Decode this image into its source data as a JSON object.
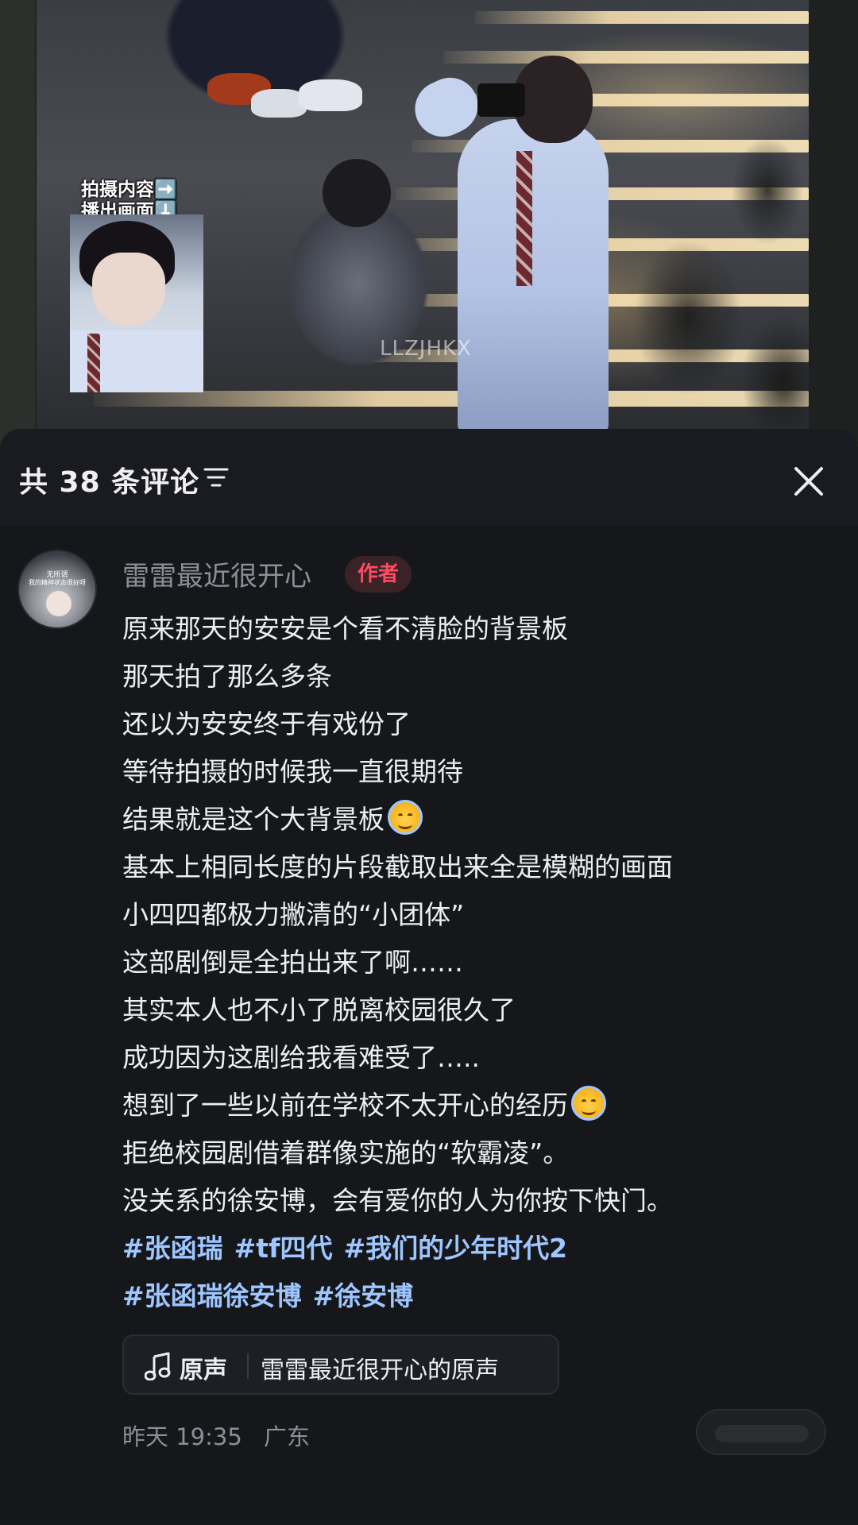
{
  "video": {
    "inset_caption_line1": "拍摄内容➡️",
    "inset_caption_line2": "播出画面⬇️",
    "watermark": "LLZJHKX"
  },
  "comments_panel": {
    "title": "共 38 条评论",
    "sort_icon": "sort-filter-icon",
    "close_icon": "close-icon"
  },
  "comment": {
    "username": "雷雷最近很开心",
    "author_badge": "作者",
    "lines": [
      "原来那天的安安是个看不清脸的背景板",
      "那天拍了那么多条",
      "还以为安安终于有戏份了",
      "等待拍摄的时候我一直很期待",
      "结果就是这个大背景板",
      "基本上相同长度的片段截取出来全是模糊的画面",
      "小四四都极力撇清的“小团体”",
      "这部剧倒是全拍出来了啊……",
      "其实本人也不小了脱离校园很久了",
      "成功因为这剧给我看难受了…..",
      "想到了一些以前在学校不太开心的经历",
      "拒绝校园剧借着群像实施的“软霸凌”。",
      "没关系的徐安博，会有爱你的人为你按下快门。"
    ],
    "emoji": "smiling-face-with-halo",
    "hashtags_line1": [
      "#张函瑞",
      "#tf四代",
      "#我们的少年时代2"
    ],
    "hashtags_line2": [
      "#张函瑞徐安博",
      "#徐安博"
    ],
    "sound": {
      "icon": "music-note-icon",
      "label": "原声",
      "title": "雷雷最近很开心的原声"
    },
    "time": "昨天 19:35",
    "location": "广东",
    "avatar_text_line1": "无所谓",
    "avatar_text_line2": "我的精神状态很好呀"
  },
  "colors": {
    "panel_bg": "#16171b",
    "text_primary": "#eceef2",
    "text_secondary": "#8d8f96",
    "hashtag": "#9ec6ff",
    "author_badge_text": "#ff4b63",
    "author_badge_bg": "#3a2226"
  }
}
